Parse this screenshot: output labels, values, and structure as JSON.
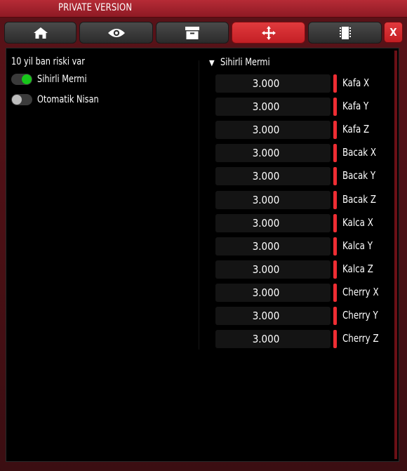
{
  "app": {
    "title": "PRIVATE VERSION"
  },
  "tabs": [
    {
      "id": "home",
      "icon": "home-icon"
    },
    {
      "id": "visuals",
      "icon": "eye-icon"
    },
    {
      "id": "inventory",
      "icon": "box-icon"
    },
    {
      "id": "aim",
      "icon": "crosshair-icon",
      "active": true
    },
    {
      "id": "misc",
      "icon": "chip-icon"
    }
  ],
  "close_label": "X",
  "left": {
    "warning": "10 yil ban riski var",
    "toggles": [
      {
        "label": "Sihirli Mermi",
        "on": true
      },
      {
        "label": "Otomatik Nisan",
        "on": false
      }
    ]
  },
  "section": {
    "title": "Sihirli Mermi",
    "fields": [
      {
        "value": "3.000",
        "label": "Kafa X"
      },
      {
        "value": "3.000",
        "label": "Kafa Y"
      },
      {
        "value": "3.000",
        "label": "Kafa Z"
      },
      {
        "value": "3.000",
        "label": "Bacak X"
      },
      {
        "value": "3.000",
        "label": "Bacak Y"
      },
      {
        "value": "3.000",
        "label": "Bacak Z"
      },
      {
        "value": "3.000",
        "label": "Kalca X"
      },
      {
        "value": "3.000",
        "label": "Kalca Y"
      },
      {
        "value": "3.000",
        "label": "Kalca Z"
      },
      {
        "value": "3.000",
        "label": "Cherry X"
      },
      {
        "value": "3.000",
        "label": "Cherry Y"
      },
      {
        "value": "3.000",
        "label": "Cherry Z"
      }
    ]
  },
  "colors": {
    "accent": "#d92b30",
    "toggle_on": "#17c61a",
    "panel_bg": "#000000"
  }
}
